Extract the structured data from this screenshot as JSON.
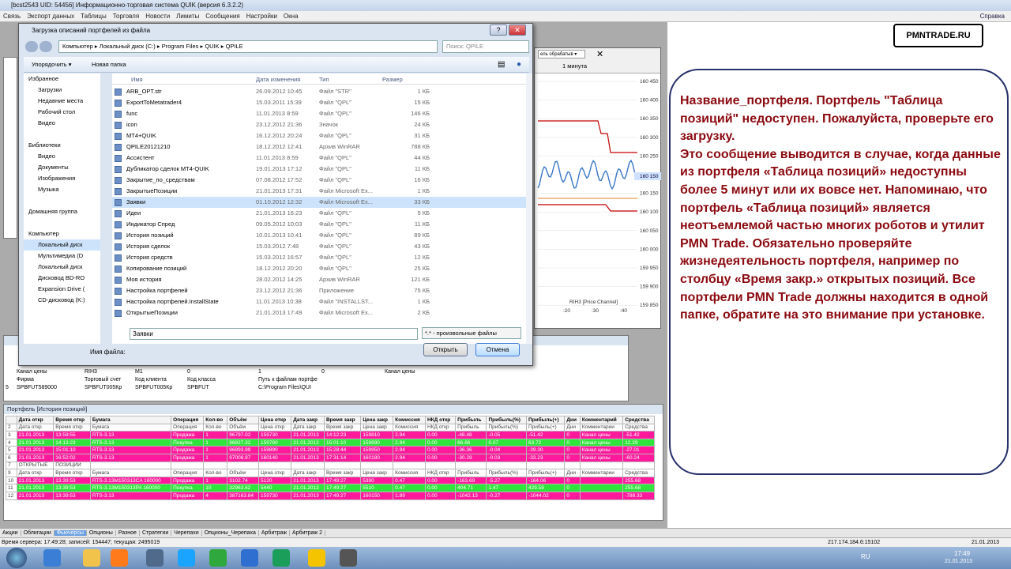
{
  "app": {
    "title": "[bcst2543  UID: 54456] Информационно-торговая система QUIK (версия 6.3.2.2)",
    "menu": [
      "Связь",
      "Экспорт данных",
      "Таблицы",
      "Торговля",
      "Новости",
      "Лимиты",
      "Сообщения",
      "Настройки",
      "Окна"
    ],
    "help": "Справка"
  },
  "logo": "PMNTRADE.RU",
  "callout": "Название_портфеля. Портфель \"Таблица позиций\" недоступен. Пожалуйста, проверьте его загрузку.\nЭто сообщение выводится в случае, когда данные из портфеля «Таблица позиций» недоступны более 5 минут или их вовсе нет. Напоминаю, что портфель «Таблица позиций» является неотъемлемой частью многих роботов и утилит PMN Trade. Обязательно проверяйте жизнедеятельность портфеля, например по столбцу «Время закр.» открытых позиций. Все портфели PMN Trade должны находится в одной папке, обратите на это внимание при установке.",
  "chart": {
    "period": "1 минута",
    "caption": "RIH3 [Price Channel]",
    "y_ticks": [
      "160 450",
      "160 400",
      "160 350",
      "160 300",
      "160 250",
      "160 200",
      "160 150",
      "160 100",
      "160 050",
      "160 000",
      "159 950",
      "159 900",
      "159 850"
    ],
    "last_price": "160 150",
    "x_ticks": [
      ":20",
      ":30",
      ":40"
    ],
    "colors": {
      "channel": "#c40000",
      "price": "#3a78c8",
      "mid": "#e08020"
    }
  },
  "dialog": {
    "title": "Загрузка описаний портфелей из файла",
    "path": [
      "Компьютер",
      "Локальный диск (C:)",
      "Program Files",
      "QUIK",
      "QPILE"
    ],
    "search_placeholder": "Поиск: QPILE",
    "toolbar": {
      "organize": "Упорядочить ▾",
      "new_folder": "Новая папка"
    },
    "nav": [
      "Избранное",
      "Загрузки",
      "Недавние места",
      "Рабочий стол",
      "Видео",
      "",
      "Библиотеки",
      "Видео",
      "Документы",
      "Изображения",
      "Музыка",
      "",
      "Домашняя группа",
      "",
      "Компьютер",
      "Локальный диск",
      "Мультимедиа (D",
      "Локальный диск",
      "Дисковод BD-RO",
      "Expansion Drive (",
      "CD-дисковод (K:)"
    ],
    "columns": {
      "name": "Имя",
      "date": "Дата изменения",
      "type": "Тип",
      "size": "Размер"
    },
    "files": [
      {
        "name": "ARB_OPT.str",
        "date": "26.09.2012 10:45",
        "type": "Файл \"STR\"",
        "size": "1 КБ"
      },
      {
        "name": "ExportToMetatrader4",
        "date": "15.03.2011 15:39",
        "type": "Файл \"QPL\"",
        "size": "15 КБ"
      },
      {
        "name": "func",
        "date": "11.01.2013 8:59",
        "type": "Файл \"QPL\"",
        "size": "146 КБ"
      },
      {
        "name": "icon",
        "date": "23.12.2012 21:36",
        "type": "Значок",
        "size": "24 КБ"
      },
      {
        "name": "MT4+QUIK",
        "date": "16.12.2012 20:24",
        "type": "Файл \"QPL\"",
        "size": "31 КБ"
      },
      {
        "name": "QPILE20121210",
        "date": "18.12.2012 12:41",
        "type": "Архив WinRAR",
        "size": "788 КБ"
      },
      {
        "name": "Ассистент",
        "date": "11.01.2013 8:59",
        "type": "Файл \"QPL\"",
        "size": "44 КБ"
      },
      {
        "name": "Дубликатор сделок MT4-QUIK",
        "date": "19.01.2013 17:12",
        "type": "Файл \"QPL\"",
        "size": "11 КБ"
      },
      {
        "name": "Закрытие_по_средствам",
        "date": "07.08.2012 17:52",
        "type": "Файл \"QPL\"",
        "size": "16 КБ"
      },
      {
        "name": "ЗакрытыеПозиции",
        "date": "21.01.2013 17:31",
        "type": "Файл Microsoft Ex...",
        "size": "1 КБ"
      },
      {
        "name": "Заявки",
        "date": "01.10.2012 12:32",
        "type": "Файл Microsoft Ex...",
        "size": "33 КБ",
        "selected": true
      },
      {
        "name": "Идеи",
        "date": "21.01.2013 16:23",
        "type": "Файл \"QPL\"",
        "size": "5 КБ"
      },
      {
        "name": "Индикатор Спред",
        "date": "09.05.2012 10:03",
        "type": "Файл \"QPL\"",
        "size": "11 КБ"
      },
      {
        "name": "История позиций",
        "date": "10.01.2013 10:41",
        "type": "Файл \"QPL\"",
        "size": "89 КБ"
      },
      {
        "name": "История сделок",
        "date": "15.03.2012 7:48",
        "type": "Файл \"QPL\"",
        "size": "43 КБ"
      },
      {
        "name": "История средств",
        "date": "15.03.2012 16:57",
        "type": "Файл \"QPL\"",
        "size": "12 КБ"
      },
      {
        "name": "Копирование позиций",
        "date": "18.12.2012 20:20",
        "type": "Файл \"QPL\"",
        "size": "25 КБ"
      },
      {
        "name": "Моя история",
        "date": "28.02.2012 14:25",
        "type": "Архив WinRAR",
        "size": "121 КБ"
      },
      {
        "name": "Настройка портфелей",
        "date": "23.12.2012 21:36",
        "type": "Приложение",
        "size": "75 КБ"
      },
      {
        "name": "Настройка портфелей.InstallState",
        "date": "11.01.2013 10:38",
        "type": "Файл \"INSTALLST...",
        "size": "1 КБ"
      },
      {
        "name": "ОткрытыеПозиции",
        "date": "21.01.2013 17:49",
        "type": "Файл Microsoft Ex...",
        "size": "2 КБ"
      }
    ],
    "filename_label": "Имя файла:",
    "filename": "Заявки",
    "filetype": "*.* - произвольные файлы",
    "open": "Открыть",
    "cancel": "Отмена"
  },
  "portfolio_mini": {
    "rows": [
      [
        "",
        "Канал цены",
        "RIH3",
        "M1",
        "0",
        "1",
        "0",
        "Канал цены"
      ],
      [
        "",
        "Фирма",
        "Торговый счет",
        "Код клиента",
        "Код класса",
        "Путь к файлам портфе"
      ],
      [
        "5",
        "SPBFUT589000",
        "SPBFUT005Кр",
        "SPBFUT005Кр",
        "SPBFUT",
        "C:\\Program Files\\QUI"
      ]
    ]
  },
  "history": {
    "title": "Портфель [История позиций]",
    "header": [
      "",
      "Дата откр",
      "Время откр",
      "Бумага",
      "Операция",
      "Кол-во",
      "Объём",
      "Цена откр",
      "Дата закр",
      "Время закр",
      "Цена закр",
      "Комиссия",
      "НКД откр",
      "Прибыль",
      "Прибыль(%)",
      "Прибыль(+)",
      "Дни",
      "Комментарий",
      "Средства"
    ],
    "sub": [
      "2",
      "Дата откр",
      "Время откр",
      "Бумага",
      "Операция",
      "Кол-во",
      "Объём",
      "Цена откр",
      "Дата закр",
      "Время закр",
      "Цена закр",
      "Комиссия",
      "НКД откр",
      "Прибыль",
      "Прибыль(%)",
      "Прибыль(+)",
      "Дни",
      "Комментарии",
      "Средства"
    ],
    "rows": [
      {
        "c": "pk",
        "v": [
          "3",
          "21.01.2013",
          "13:59:55",
          "RTS-3.13",
          "Продажа",
          "1",
          "96797.02",
          "159730",
          "21.01.2013",
          "14:12:23",
          "159810",
          "2.94",
          "0.00",
          "-48.48",
          "-0.05",
          "-51.42",
          "0",
          "Канал цены",
          "-51.42"
        ]
      },
      {
        "c": "gr",
        "v": [
          "4",
          "21.01.2013",
          "14:13:23",
          "RTS-3.13",
          "Покупка",
          "1",
          "96827.32",
          "159780",
          "21.01.2013",
          "15:01:10",
          "159890",
          "2.94",
          "0.00",
          "66.66",
          "0.07",
          "63.72",
          "0",
          "Канал цены",
          "12.29"
        ]
      },
      {
        "c": "pk",
        "v": [
          "5",
          "21.01.2013",
          "15:01:10",
          "RTS-3.13",
          "Продажа",
          "1",
          "96893.99",
          "159890",
          "21.01.2013",
          "15:28:44",
          "159950",
          "2.94",
          "0.00",
          "-36.36",
          "-0.04",
          "-39.30",
          "0",
          "Канал цены",
          "-27.01"
        ]
      },
      {
        "c": "pk",
        "v": [
          "6",
          "21.01.2013",
          "16:52:02",
          "RTS-3.13",
          "Продажа",
          "1",
          "97008.97",
          "160140",
          "21.01.2013",
          "17:31:14",
          "160180",
          "2.94",
          "0.00",
          "-30.29",
          "-0.03",
          "-33.23",
          "0",
          "Канал цены",
          "-60.24"
        ]
      },
      {
        "c": "hd2",
        "v": [
          "7",
          "ОТКРЫТЫЕ",
          "ПОЗИЦИИ",
          "",
          "",
          "",
          "",
          "",
          "",
          "",
          "",
          "",
          "",
          "",
          "",
          "",
          "",
          "",
          ""
        ]
      },
      {
        "c": "hd2",
        "v": [
          "9",
          "Дата откр",
          "Время откр",
          "Бумага",
          "Операция",
          "Кол-во",
          "Объём",
          "Цена откр",
          "Дата закр",
          "Время закр",
          "Цена закр",
          "Комиссия",
          "НКД откр",
          "Прибыль",
          "Прибыль(%)",
          "Прибыль(+)",
          "Дни",
          "Комментарии",
          "Средства"
        ]
      },
      {
        "c": "pk",
        "v": [
          "10",
          "21.01.2013",
          "13:39:53",
          "RTS-3.13M150313CA 160000",
          "Продажа",
          "1",
          "3102.74",
          "5120",
          "21.01.2013",
          "17:49:27",
          "5390",
          "0.47",
          "0.00",
          "-163.69",
          "-5.27",
          "-164.06",
          "0",
          "",
          "255.68"
        ]
      },
      {
        "c": "gr",
        "v": [
          "11",
          "21.01.2013",
          "13:39:53",
          "RTS-3.13M150313PA 160000",
          "Покупка",
          "10",
          "32963.62",
          "5440",
          "21.01.2013",
          "17:49:27",
          "5510",
          "0.47",
          "0.00",
          "404.71",
          "1.47",
          "429.58",
          "0",
          "",
          "255.68"
        ]
      },
      {
        "c": "pk",
        "v": [
          "12",
          "21.01.2013",
          "13:39:53",
          "RTS-3.13",
          "Продажа",
          "4",
          "387163.84",
          "159730",
          "21.01.2013",
          "17:49:27",
          "160150",
          "1.89",
          "0.00",
          "-1042.13",
          "-0.27",
          "-1044.02",
          "0",
          "",
          "-788.33"
        ]
      }
    ]
  },
  "tabs": [
    "Акции",
    "Облигации",
    "Фьючерсы",
    "Опционы",
    "Разное",
    "Стратегии",
    "Черепахи",
    "Опционы_Черепаха",
    "Арбитраж",
    "Арбитраж 2"
  ],
  "active_tab": "Фьючерсы",
  "status": {
    "server": "Время сервера: 17:49:28; записей: 154447; текущая: 2495019",
    "ip": "217.174.184.6:15102",
    "date": "21.01.2013"
  },
  "taskbar": {
    "lang": "RU",
    "time": "17:49",
    "date": "21.01.2013"
  }
}
